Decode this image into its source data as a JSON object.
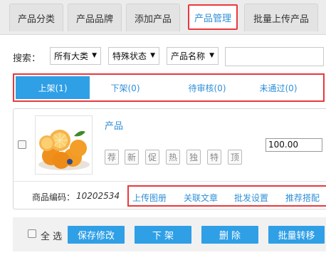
{
  "tabs": [
    {
      "label": "产品分类"
    },
    {
      "label": "产品品牌"
    },
    {
      "label": "添加产品"
    },
    {
      "label": "产品管理"
    },
    {
      "label": "批量上传产品"
    }
  ],
  "search": {
    "label": "搜索：",
    "category": "所有大类",
    "status": "特殊状态",
    "field": "产品名称",
    "keyword": ""
  },
  "status_tabs": [
    {
      "label": "上架(1)"
    },
    {
      "label": "下架(0)"
    },
    {
      "label": "待审核(0)"
    },
    {
      "label": "未通过(0)"
    }
  ],
  "product": {
    "name": "产品",
    "tags": [
      "荐",
      "新",
      "促",
      "热",
      "独",
      "特",
      "顶"
    ],
    "price": "100.00",
    "code_label": "商品编码：",
    "code": "10202534",
    "links": [
      "上传图册",
      "关联文章",
      "批发设置",
      "推荐搭配"
    ]
  },
  "footer": {
    "select_all": "全 选",
    "buttons": [
      "保存修改",
      "下 架",
      "删 除",
      "批量转移"
    ]
  },
  "colors": {
    "accent": "#2f9fe6",
    "highlight_border": "#e8393c"
  }
}
